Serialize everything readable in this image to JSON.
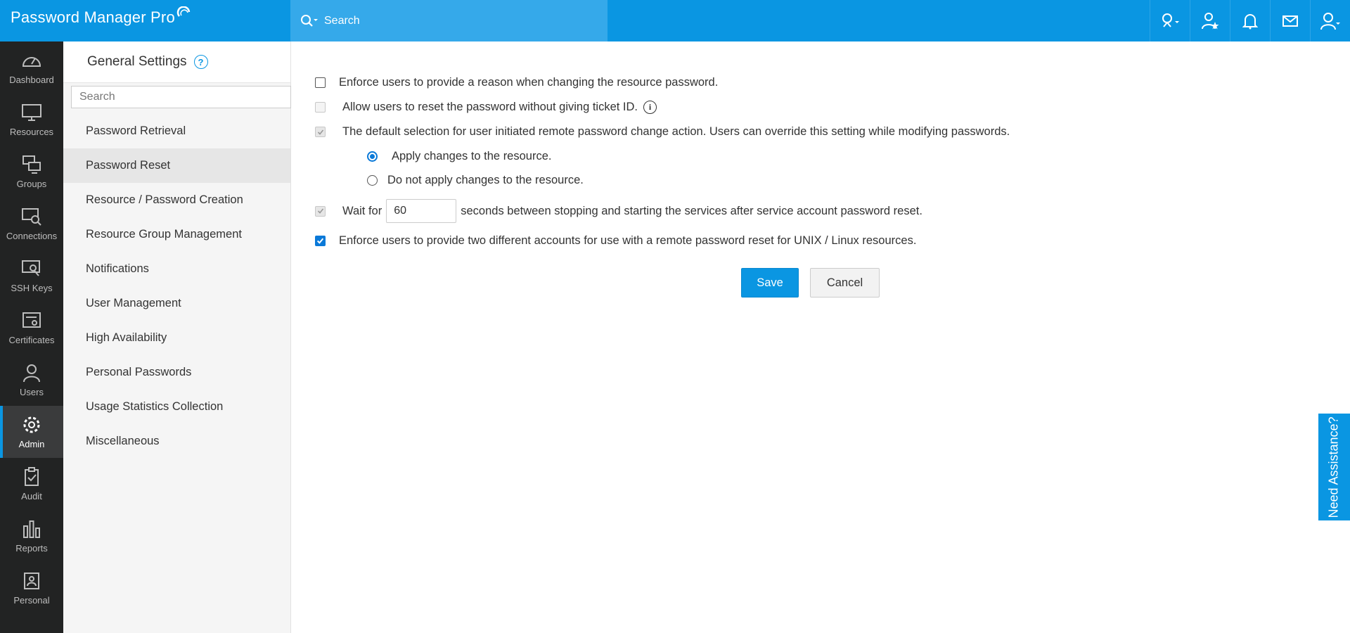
{
  "app": {
    "title": "Password Manager Pro"
  },
  "search": {
    "placeholder": "Search"
  },
  "leftnav": [
    {
      "label": "Dashboard",
      "icon": "dashboard-icon"
    },
    {
      "label": "Resources",
      "icon": "monitor-icon"
    },
    {
      "label": "Groups",
      "icon": "groups-icon"
    },
    {
      "label": "Connections",
      "icon": "connections-icon"
    },
    {
      "label": "SSH Keys",
      "icon": "ssh-key-icon"
    },
    {
      "label": "Certificates",
      "icon": "certificate-icon"
    },
    {
      "label": "Users",
      "icon": "user-icon"
    },
    {
      "label": "Admin",
      "icon": "gear-icon"
    },
    {
      "label": "Audit",
      "icon": "clipboard-icon"
    },
    {
      "label": "Reports",
      "icon": "bar-chart-icon"
    },
    {
      "label": "Personal",
      "icon": "contact-card-icon"
    }
  ],
  "settings": {
    "title": "General Settings",
    "help": "?",
    "search_placeholder": "Search",
    "items": [
      "Password Retrieval",
      "Password Reset",
      "Resource / Password Creation",
      "Resource Group Management",
      "Notifications",
      "User Management",
      "High Availability",
      "Personal Passwords",
      "Usage Statistics Collection",
      "Miscellaneous"
    ],
    "active": "Password Reset"
  },
  "form": {
    "opt_reason": "Enforce users to provide a reason when changing the resource password.",
    "opt_ticket": "Allow users to reset the password without giving ticket ID.",
    "opt_default_selection": "The default selection for user initiated remote password change action. Users can override this setting while modifying passwords.",
    "radio_apply": "Apply changes to the resource.",
    "radio_not_apply": "Do not apply changes to the resource.",
    "wait_prefix": "Wait for",
    "wait_value": "60",
    "wait_suffix": "seconds between stopping and starting the services after service account password reset.",
    "opt_two_accounts": "Enforce users to provide two different accounts for use with a remote password reset for UNIX / Linux resources.",
    "save": "Save",
    "cancel": "Cancel"
  },
  "assist": "Need Assistance?",
  "colors": {
    "primary": "#0a96e2",
    "nav_bg": "#222323",
    "sidebar_bg": "#f5f5f5"
  }
}
